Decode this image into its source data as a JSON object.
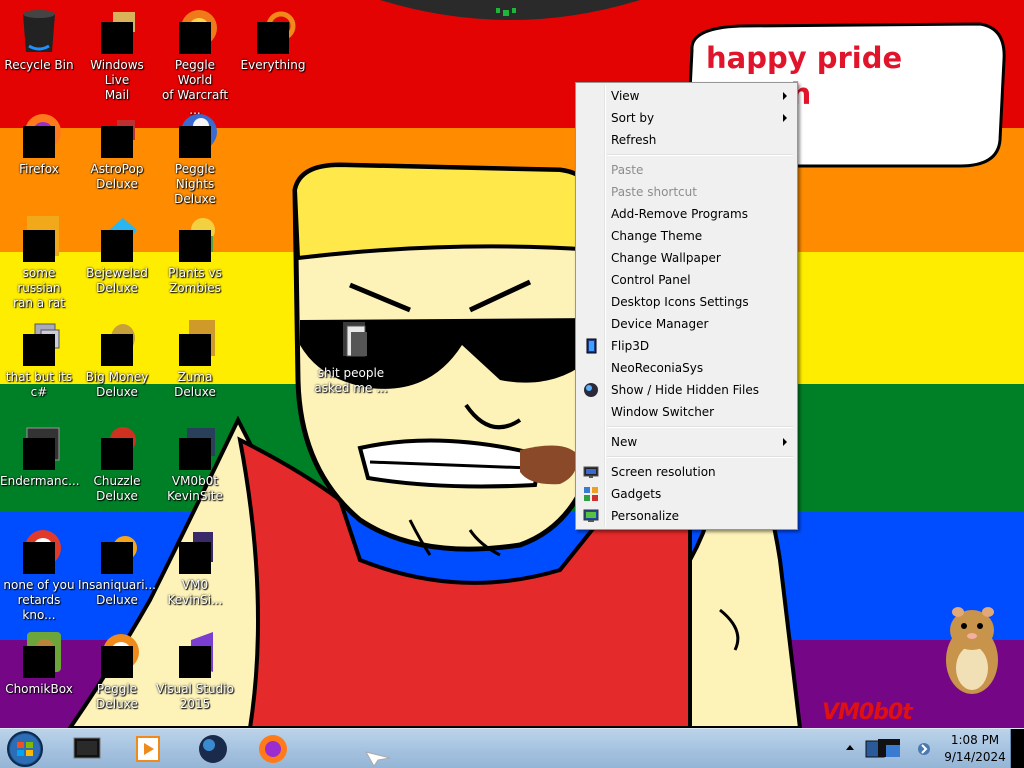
{
  "wallpaper": {
    "speech_text": "happy pride month\nne!",
    "watermark": "VM0b0t",
    "folder_label": "shit people\nasked me ..."
  },
  "desktop_icons": [
    {
      "label": "Recycle Bin",
      "icon": "recycle-bin-icon"
    },
    {
      "label": "Windows Live\nMail",
      "icon": "windows-live-mail-icon"
    },
    {
      "label": "Peggle World\nof Warcraft ...",
      "icon": "peggle-wow-icon"
    },
    {
      "label": "Everything",
      "icon": "everything-search-icon"
    },
    {
      "label": "Firefox",
      "icon": "firefox-icon"
    },
    {
      "label": "AstroPop\nDeluxe",
      "icon": "astropop-icon"
    },
    {
      "label": "Peggle Nights\nDeluxe",
      "icon": "peggle-nights-icon"
    },
    {
      "label": "some russian\nran a rat",
      "icon": "game-icon"
    },
    {
      "label": "Bejeweled\nDeluxe",
      "icon": "bejeweled-icon"
    },
    {
      "label": "Plants vs\nZombies",
      "icon": "plants-vs-zombies-icon"
    },
    {
      "label": "that but its c#",
      "icon": "shortcut-icon"
    },
    {
      "label": "Big Money\nDeluxe",
      "icon": "big-money-icon"
    },
    {
      "label": "Zuma Deluxe",
      "icon": "zuma-icon"
    },
    {
      "label": "Endermanc...",
      "icon": "console-app-icon"
    },
    {
      "label": "Chuzzle\nDeluxe",
      "icon": "chuzzle-icon"
    },
    {
      "label": "VM0b0t\nKevinSite",
      "icon": "website-icon"
    },
    {
      "label": "none of you\nretards kno...",
      "icon": "browser-shortcut-icon"
    },
    {
      "label": "Insaniquari...\nDeluxe",
      "icon": "insaniquarium-icon"
    },
    {
      "label": "VM0\nKevinSi...",
      "icon": "visual-studio-project-icon"
    },
    {
      "label": "ChomikBox",
      "icon": "chomikbox-icon"
    },
    {
      "label": "Peggle Deluxe",
      "icon": "peggle-deluxe-icon"
    },
    {
      "label": "Visual Studio\n2015",
      "icon": "visual-studio-icon"
    }
  ],
  "context_menu": {
    "items": [
      {
        "label": "View",
        "submenu": true
      },
      {
        "label": "Sort by",
        "submenu": true
      },
      {
        "label": "Refresh"
      },
      {
        "label": "Paste",
        "disabled": true
      },
      {
        "label": "Paste shortcut",
        "disabled": true
      },
      {
        "label": "Add-Remove Programs"
      },
      {
        "label": "Change Theme"
      },
      {
        "label": "Change Wallpaper"
      },
      {
        "label": "Control Panel"
      },
      {
        "label": "Desktop Icons Settings"
      },
      {
        "label": "Device Manager"
      },
      {
        "label": "Flip3D",
        "icon": "flip3d-icon"
      },
      {
        "label": "NeoReconiaSys"
      },
      {
        "label": "Show / Hide Hidden Files",
        "icon": "globe-icon"
      },
      {
        "label": "Window Switcher"
      },
      {
        "label": "New",
        "submenu": true
      },
      {
        "label": "Screen resolution",
        "icon": "monitor-icon"
      },
      {
        "label": "Gadgets",
        "icon": "gadgets-icon"
      },
      {
        "label": "Personalize",
        "icon": "personalize-icon"
      }
    ]
  },
  "taskbar": {
    "pinned": [
      "cmd-window-icon",
      "media-player-icon",
      "browser-globe-icon",
      "firefox-icon"
    ],
    "clock_time": "1:08 PM",
    "clock_date": "9/14/2024"
  },
  "colors": {
    "stripe_red": "#e40303",
    "stripe_orange": "#ff8c00",
    "stripe_yellow": "#ffed00",
    "stripe_green": "#008026",
    "stripe_blue": "#004dff",
    "stripe_purple": "#750787",
    "speech_text": "#e0152b"
  }
}
